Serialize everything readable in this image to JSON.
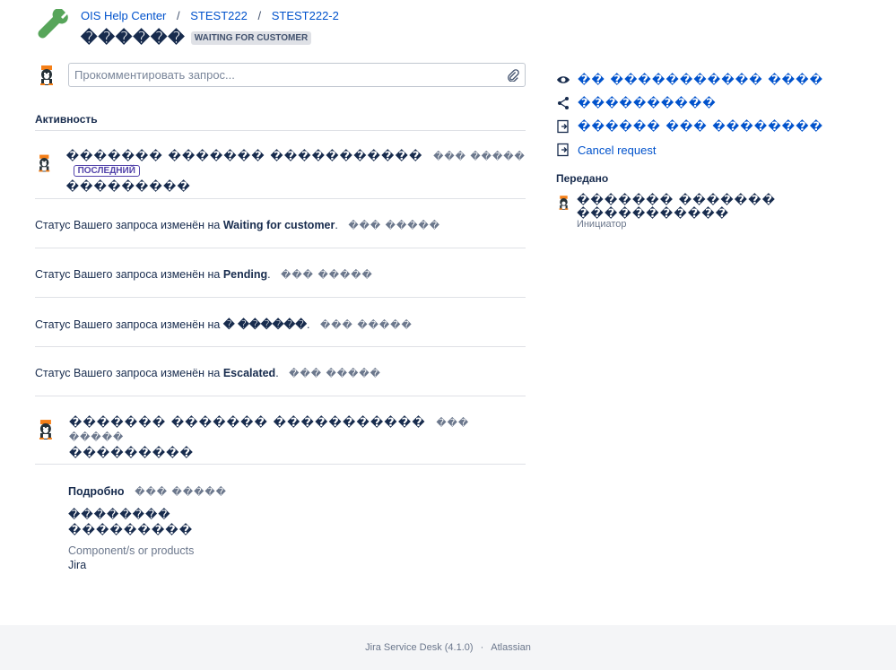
{
  "header": {
    "breadcrumbs": [
      "OIS Help Center",
      "STEST222",
      "STEST222-2"
    ],
    "title": "������",
    "status": "WAITING FOR CUSTOMER"
  },
  "comment": {
    "placeholder": "Прокомментировать запрос..."
  },
  "activity": {
    "title": "Активность",
    "latest_label": "ПОСЛЕДНИЙ",
    "events": [
      {
        "author": "������� ������� �����������",
        "time": "��� �����",
        "text": "���������"
      },
      {
        "prefix": "Статус Вашего запроса изменён на ",
        "status": "Waiting for customer",
        "suffix": ".",
        "time": "��� �����"
      },
      {
        "prefix": "Статус Вашего запроса изменён на ",
        "status": "Pending",
        "suffix": ".",
        "time": "��� �����"
      },
      {
        "prefix": "Статус Вашего запроса изменён на ",
        "status": "� ������",
        "suffix": ".",
        "time": "��� �����"
      },
      {
        "prefix": "Статус Вашего запроса изменён на ",
        "status": "Escalated",
        "suffix": ".",
        "time": "��� �����"
      },
      {
        "author": "������� ������� �����������",
        "time": "��� �����",
        "text": "���������"
      }
    ]
  },
  "details": {
    "title": "Подробно",
    "time": "��� �����",
    "field1_label": "��������",
    "field1_value": "���������",
    "field2_label": "Component/s or products",
    "field2_value": "Jira"
  },
  "sidebar": {
    "actions": [
      {
        "icon": "eye-icon",
        "label": "�� ����������� ����"
      },
      {
        "icon": "share-icon",
        "label": "����������"
      },
      {
        "icon": "exit-icon",
        "label": "������ ��� ��������"
      },
      {
        "icon": "exit-icon",
        "label": "Cancel request"
      }
    ],
    "shared_title": "Передано",
    "shared_name": "������� ������� �����������",
    "shared_role": "Инициатор"
  },
  "footer": {
    "product": "Jira Service Desk (4.1.0)",
    "vendor": "Atlassian"
  },
  "colors": {
    "link": "#0052cc",
    "text": "#172b4d",
    "muted": "#6b778c",
    "border": "#dfe1e6",
    "latest": "#5243aa",
    "logo": "#57a55a"
  }
}
